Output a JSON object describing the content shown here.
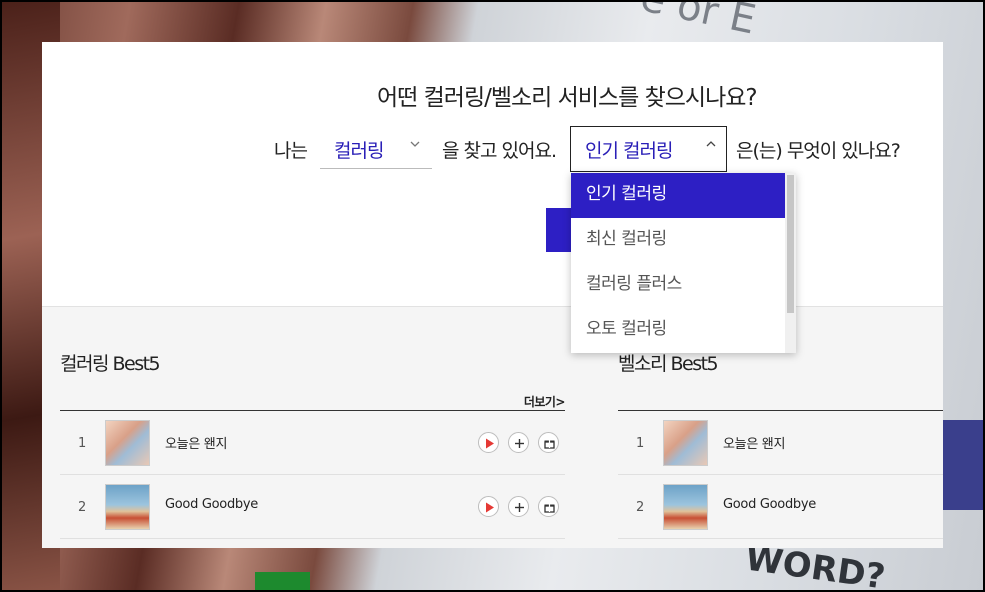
{
  "background": {
    "text_fragment_top": "e or E",
    "text_fragment_bottom": "WORD?"
  },
  "finder": {
    "question": "어떤 컬러링/벨소리 서비스를 찾으시나요?",
    "prefix": "나는",
    "service_select": {
      "value": "컬러링"
    },
    "middle": "을 찾고 있어요.",
    "category_select": {
      "value": "인기 컬러링"
    },
    "suffix": "은(는) 무엇이 있나요?",
    "options": [
      "인기 컬러링",
      "최신 컬러링",
      "컬러링 플러스",
      "오토 컬러링"
    ],
    "selected_option_index": 0
  },
  "best_coloring": {
    "title": "컬러링 Best5",
    "more_label": "더보기>",
    "items": [
      {
        "rank": "1",
        "title": "오늘은 왠지"
      },
      {
        "rank": "2",
        "title": "Good Goodbye"
      }
    ]
  },
  "best_bell": {
    "title": "벨소리 Best5",
    "items": [
      {
        "rank": "1",
        "title": "오늘은 왠지"
      },
      {
        "rank": "2",
        "title": "Good Goodbye"
      }
    ]
  },
  "colors": {
    "accent": "#2d1fc4",
    "select_text": "#2a1fb7",
    "play_icon": "#e53935"
  },
  "icons": {
    "chevron_down": "chevron-down-icon",
    "chevron_up": "chevron-up-icon",
    "play": "play-icon",
    "add": "plus-icon",
    "gift": "gift-icon"
  }
}
